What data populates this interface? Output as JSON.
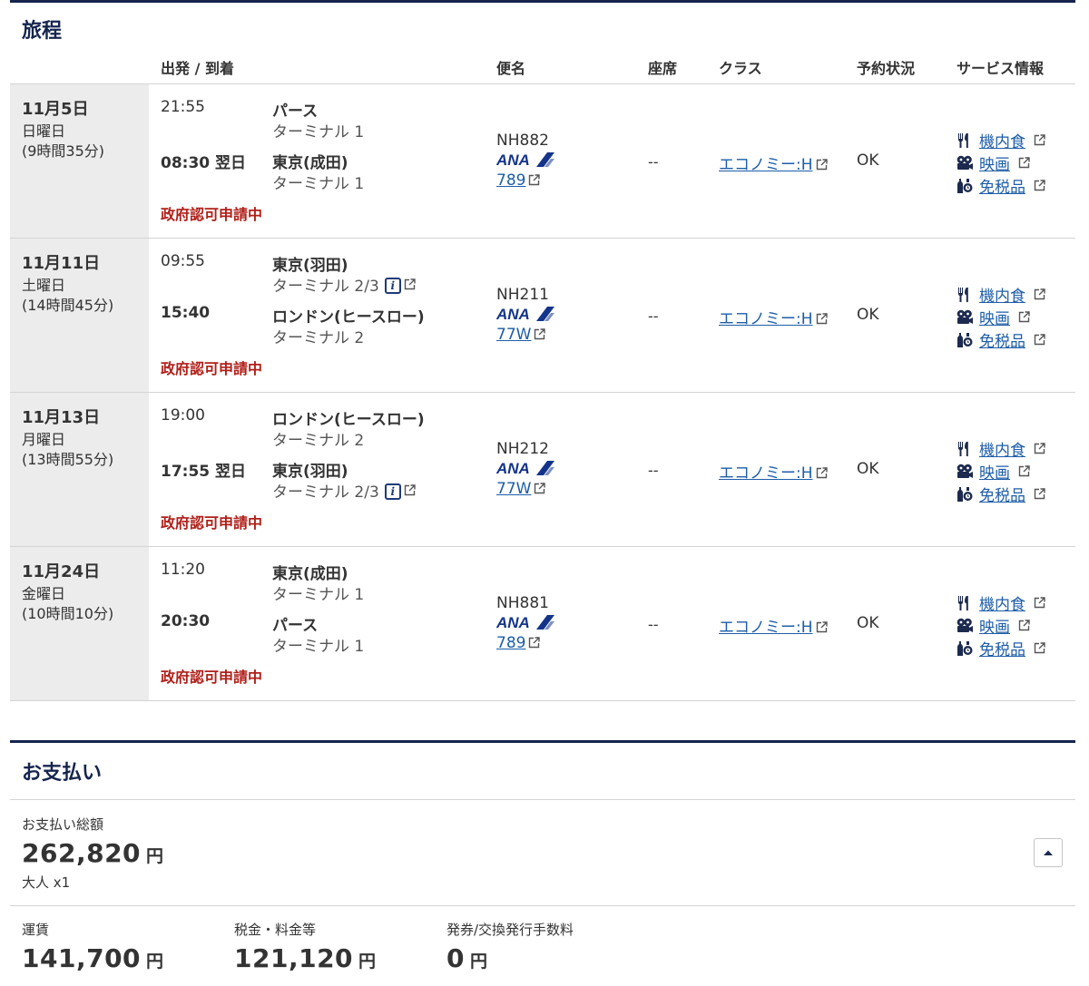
{
  "itinerary": {
    "title": "旅程",
    "headers": {
      "depart_arrive": "出発 / 到着",
      "flight": "便名",
      "seat": "座席",
      "class": "クラス",
      "status": "予約状況",
      "service": "サービス情報"
    },
    "segments": [
      {
        "date": "11月5日",
        "weekday": "日曜日",
        "duration": "(9時間35分)",
        "dep_time": "21:55",
        "dep_airport": "パース",
        "dep_terminal": "ターミナル 1",
        "arr_time": "08:30 翌日",
        "arr_airport": "東京(成田)",
        "arr_terminal": "ターミナル 1",
        "notice": "政府認可申請中",
        "flight_no": "NH882",
        "aircraft": "789",
        "seat": "--",
        "class": "エコノミー:H",
        "status": "OK"
      },
      {
        "date": "11月11日",
        "weekday": "土曜日",
        "duration": "(14時間45分)",
        "dep_time": "09:55",
        "dep_airport": "東京(羽田)",
        "dep_terminal": "ターミナル 2/3",
        "arr_time": "15:40",
        "arr_airport": "ロンドン(ヒースロー)",
        "arr_terminal": "ターミナル 2",
        "notice": "政府認可申請中",
        "flight_no": "NH211",
        "aircraft": "77W",
        "seat": "--",
        "class": "エコノミー:H",
        "status": "OK"
      },
      {
        "date": "11月13日",
        "weekday": "月曜日",
        "duration": "(13時間55分)",
        "dep_time": "19:00",
        "dep_airport": "ロンドン(ヒースロー)",
        "dep_terminal": "ターミナル 2",
        "arr_time": "17:55 翌日",
        "arr_airport": "東京(羽田)",
        "arr_terminal": "ターミナル 2/3",
        "notice": "政府認可申請中",
        "flight_no": "NH212",
        "aircraft": "77W",
        "seat": "--",
        "class": "エコノミー:H",
        "status": "OK"
      },
      {
        "date": "11月24日",
        "weekday": "金曜日",
        "duration": "(10時間10分)",
        "dep_time": "11:20",
        "dep_airport": "東京(成田)",
        "dep_terminal": "ターミナル 1",
        "arr_time": "20:30",
        "arr_airport": "パース",
        "arr_terminal": "ターミナル 1",
        "notice": "政府認可申請中",
        "flight_no": "NH881",
        "aircraft": "789",
        "seat": "--",
        "class": "エコノミー:H",
        "status": "OK"
      }
    ],
    "services": {
      "meal": "機内食",
      "movie": "映画",
      "duty_free": "免税品"
    },
    "airline_logo_text": "ANA"
  },
  "payment": {
    "title": "お支払い",
    "total_label": "お支払い総額",
    "total_amount": "262,820",
    "currency": "円",
    "passengers": "大人 x1",
    "breakdown": [
      {
        "label": "運賃",
        "amount": "141,700"
      },
      {
        "label": "税金・料金等",
        "amount": "121,120"
      },
      {
        "label": "発券/交換発行手数料",
        "amount": "0"
      }
    ]
  },
  "colors": {
    "navy": "#16254e",
    "link": "#1d5da8",
    "notice_red": "#b0201a",
    "date_bg": "#ececec"
  }
}
